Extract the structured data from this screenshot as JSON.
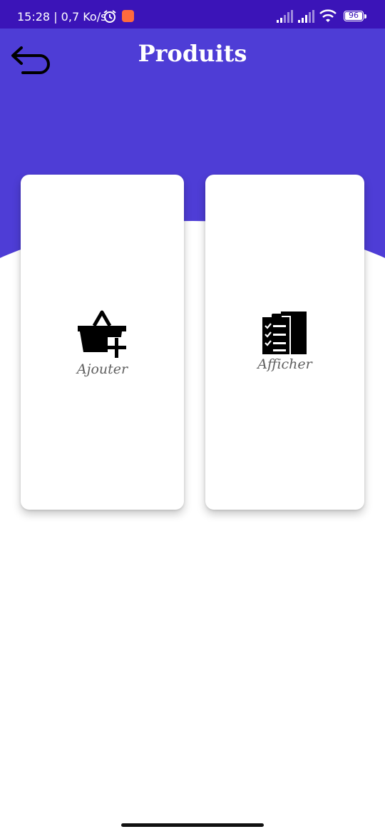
{
  "status_bar": {
    "time": "15:28 | 0,7 Ko/s",
    "battery_level": "96"
  },
  "header": {
    "title": "Produits",
    "back_icon": "undo-arrow-icon",
    "background_color": "#4e3dd6",
    "status_bar_color": "#3b14b8"
  },
  "cards": {
    "add": {
      "label": "Ajouter",
      "icon": "basket-plus-icon"
    },
    "view": {
      "label": "Afficher",
      "icon": "clipboard-checklist-icon"
    }
  }
}
